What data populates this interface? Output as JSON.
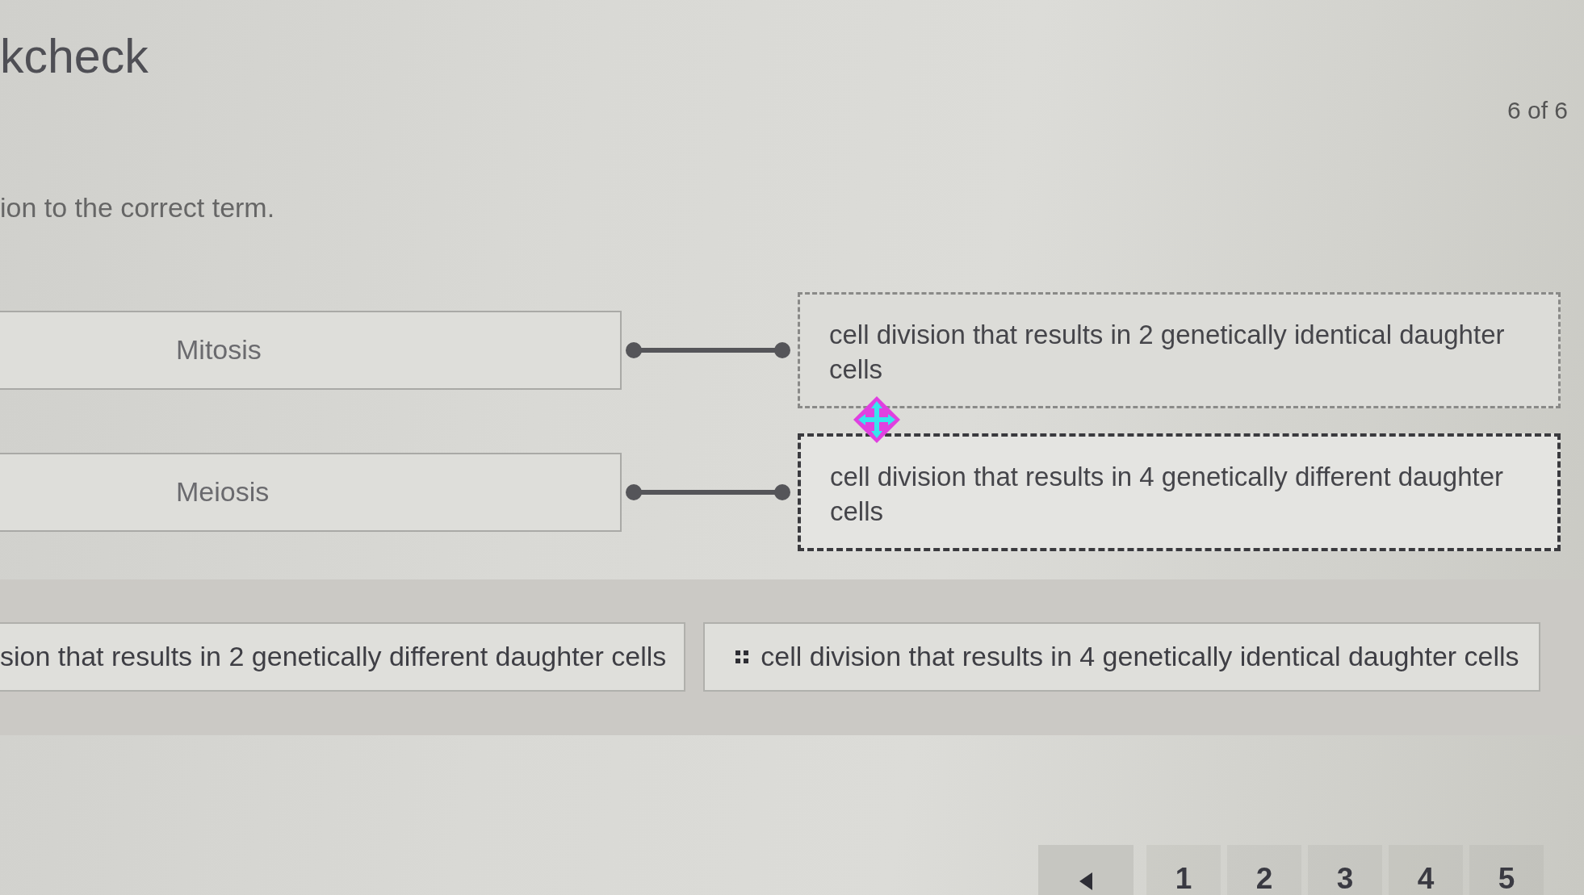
{
  "header": {
    "title": "kcheck",
    "counter": "6 of 6",
    "instruction": "ion to the correct term."
  },
  "matches": [
    {
      "term": "Mitosis",
      "answer": "cell division that results in 2 genetically identical daughter cells",
      "selected": false
    },
    {
      "term": "Meiosis",
      "answer": "cell division that results in 4 genetically different daughter cells",
      "selected": true
    }
  ],
  "answer_bank": [
    {
      "text": "sion that results in 2 genetically different daughter cells",
      "handle": false
    },
    {
      "text": "cell division that results in 4 genetically identical daughter cells",
      "handle": true
    }
  ],
  "pagination": {
    "pages": [
      {
        "label": "1",
        "selected": false
      },
      {
        "label": "2",
        "selected": false
      },
      {
        "label": "3",
        "selected": false
      },
      {
        "label": "4",
        "selected": false
      },
      {
        "label": "5",
        "selected": false
      }
    ]
  }
}
